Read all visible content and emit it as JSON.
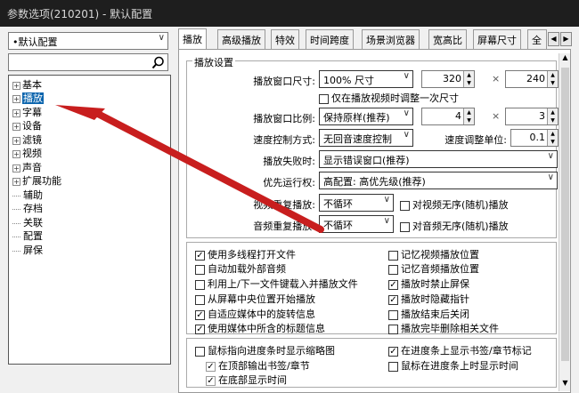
{
  "window": {
    "title": "参数选项(210201) - 默认配置"
  },
  "left": {
    "profile_select": "•默认配置",
    "search_placeholder": "",
    "tree": [
      {
        "label": "基本",
        "expander": "+"
      },
      {
        "label": "播放",
        "expander": "+",
        "selected": true
      },
      {
        "label": "字幕",
        "expander": "+"
      },
      {
        "label": "设备",
        "expander": "+"
      },
      {
        "label": "滤镜",
        "expander": "+"
      },
      {
        "label": "视频",
        "expander": "+"
      },
      {
        "label": "声音",
        "expander": "+"
      },
      {
        "label": "扩展功能",
        "expander": "+"
      },
      {
        "label": "辅助",
        "expander": ""
      },
      {
        "label": "存档",
        "expander": ""
      },
      {
        "label": "关联",
        "expander": ""
      },
      {
        "label": "配置",
        "expander": ""
      },
      {
        "label": "屏保",
        "expander": ""
      }
    ]
  },
  "tabs": [
    "播放",
    "高级播放",
    "特效",
    "时间跨度",
    "场景浏览器",
    "宽高比",
    "屏幕尺寸",
    "全"
  ],
  "tab_scroll": {
    "left": "◀",
    "right": "▶"
  },
  "group_title": "播放设置",
  "fields": {
    "window_size_label": "播放窗口尺寸:",
    "window_size_value": "100% 尺寸",
    "width": "320",
    "height": "240",
    "times": "×",
    "only_adjust_once": "仅在播放视频时调整一次尺寸",
    "aspect_label": "播放窗口比例:",
    "aspect_value": "保持原样(推荐)",
    "aspect_w": "4",
    "aspect_h": "3",
    "speed_ctrl_label": "速度控制方式:",
    "speed_ctrl_value": "无回音速度控制",
    "speed_unit_label": "速度调整单位:",
    "speed_unit_value": "0.1",
    "fail_label": "播放失败时:",
    "fail_value": "显示错误窗口(推荐)",
    "priority_label": "优先运行权:",
    "priority_value": "高配置: 高优先级(推荐)",
    "video_repeat_label": "视频重复播放:",
    "video_repeat_value": "不循环",
    "video_random": "对视频无序(随机)播放",
    "audio_repeat_label": "音频重复播放:",
    "audio_repeat_value": "不循环",
    "audio_random": "对音频无序(随机)播放"
  },
  "checkboxes_a": [
    {
      "label": "使用多线程打开文件",
      "checked": true
    },
    {
      "label": "记忆视频播放位置",
      "checked": false
    },
    {
      "label": "自动加载外部音频",
      "checked": false
    },
    {
      "label": "记忆音频播放位置",
      "checked": false
    },
    {
      "label": "利用上/下一文件键载入并播放文件",
      "checked": false
    },
    {
      "label": "播放时禁止屏保",
      "checked": true
    },
    {
      "label": "从屏幕中央位置开始播放",
      "checked": false
    },
    {
      "label": "播放时隐藏指针",
      "checked": true
    },
    {
      "label": "自适应媒体中的旋转信息",
      "checked": true
    },
    {
      "label": "播放结束后关闭",
      "checked": false
    },
    {
      "label": "使用媒体中所含的标题信息",
      "checked": true
    },
    {
      "label": "播放完毕删除相关文件",
      "checked": false
    }
  ],
  "checkboxes_b": [
    {
      "label": "鼠标指向进度条时显示缩略图",
      "checked": false
    },
    {
      "label": "在进度条上显示书签/章节标记",
      "checked": true
    },
    {
      "label": "在顶部输出书签/章节",
      "checked": true
    },
    {
      "label": "鼠标在进度条上时显示时间",
      "checked": false
    },
    {
      "label": "在底部显示时间",
      "checked": true
    }
  ],
  "arrow_color": "#c81e1e",
  "selection_color": "#0a64ad"
}
